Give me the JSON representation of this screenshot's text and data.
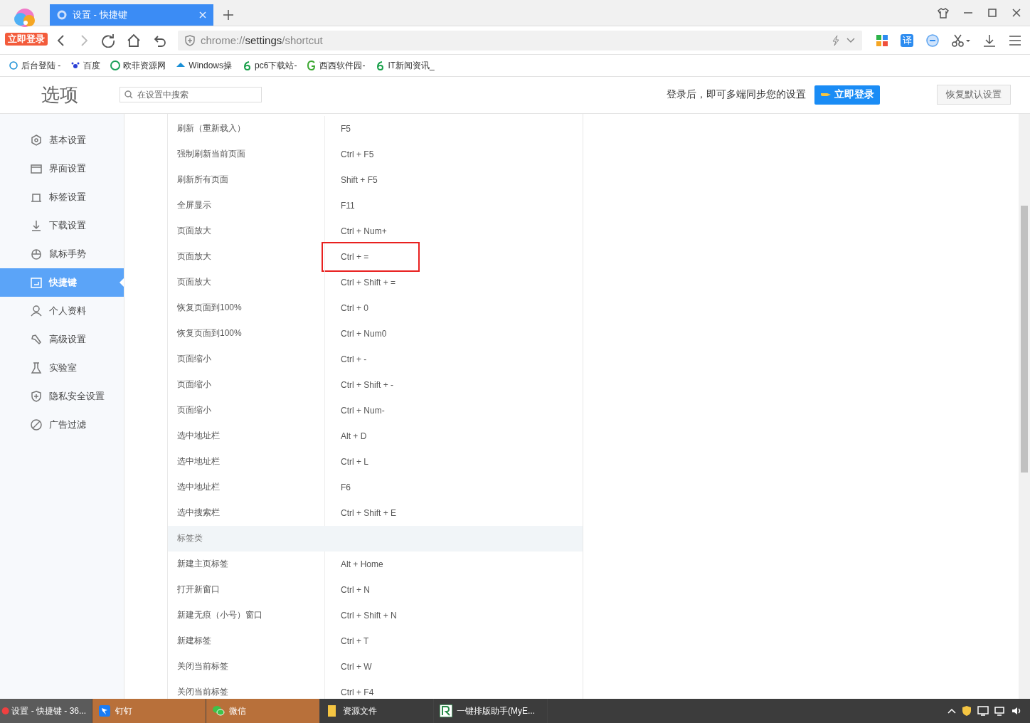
{
  "browser": {
    "badge": "立即登录",
    "tabs": [
      {
        "title": "设置 - 快捷键",
        "selected": true
      }
    ],
    "address": {
      "scheme": "chrome://",
      "host": "settings",
      "path": "/shortcut"
    },
    "translate_button": "译",
    "bookmarks": [
      "后台登陆 -",
      "百度",
      "欧菲资源网",
      "Windows操",
      "pc6下载站-",
      "西西软件园-",
      "IT新闻资讯_"
    ]
  },
  "header": {
    "title": "选项",
    "search_placeholder": "在设置中搜索",
    "sync_text": "登录后，即可多端同步您的设置",
    "login_button": "立即登录",
    "reset_button": "恢复默认设置"
  },
  "sidebar": {
    "items": [
      {
        "label": "基本设置",
        "selected": false
      },
      {
        "label": "界面设置",
        "selected": false
      },
      {
        "label": "标签设置",
        "selected": false
      },
      {
        "label": "下载设置",
        "selected": false
      },
      {
        "label": "鼠标手势",
        "selected": false
      },
      {
        "label": "快捷键",
        "selected": true
      },
      {
        "label": "个人资料",
        "selected": false
      },
      {
        "label": "高级设置",
        "selected": false
      },
      {
        "label": "实验室",
        "selected": false
      },
      {
        "label": "隐私安全设置",
        "selected": false
      },
      {
        "label": "广告过滤",
        "selected": false
      }
    ]
  },
  "shortcuts": {
    "rows": [
      {
        "kind": "shortcut",
        "action": "刷新（重新载入）",
        "keys": "F5",
        "highlighted": false
      },
      {
        "kind": "shortcut",
        "action": "强制刷新当前页面",
        "keys": "Ctrl + F5",
        "highlighted": false
      },
      {
        "kind": "shortcut",
        "action": "刷新所有页面",
        "keys": "Shift + F5",
        "highlighted": false
      },
      {
        "kind": "shortcut",
        "action": "全屏显示",
        "keys": "F11",
        "highlighted": false
      },
      {
        "kind": "shortcut",
        "action": "页面放大",
        "keys": "Ctrl + Num+",
        "highlighted": false
      },
      {
        "kind": "shortcut",
        "action": "页面放大",
        "keys": "Ctrl + =",
        "highlighted": true
      },
      {
        "kind": "shortcut",
        "action": "页面放大",
        "keys": "Ctrl + Shift + =",
        "highlighted": false
      },
      {
        "kind": "shortcut",
        "action": "恢复页面到100%",
        "keys": "Ctrl + 0",
        "highlighted": false
      },
      {
        "kind": "shortcut",
        "action": "恢复页面到100%",
        "keys": "Ctrl + Num0",
        "highlighted": false
      },
      {
        "kind": "shortcut",
        "action": "页面缩小",
        "keys": "Ctrl + -",
        "highlighted": false
      },
      {
        "kind": "shortcut",
        "action": "页面缩小",
        "keys": "Ctrl + Shift + -",
        "highlighted": false
      },
      {
        "kind": "shortcut",
        "action": "页面缩小",
        "keys": "Ctrl + Num-",
        "highlighted": false
      },
      {
        "kind": "shortcut",
        "action": "选中地址栏",
        "keys": "Alt + D",
        "highlighted": false
      },
      {
        "kind": "shortcut",
        "action": "选中地址栏",
        "keys": "Ctrl + L",
        "highlighted": false
      },
      {
        "kind": "shortcut",
        "action": "选中地址栏",
        "keys": "F6",
        "highlighted": false
      },
      {
        "kind": "shortcut",
        "action": "选中搜索栏",
        "keys": "Ctrl + Shift + E",
        "highlighted": false
      },
      {
        "kind": "section",
        "label": "标签类"
      },
      {
        "kind": "shortcut",
        "action": "新建主页标签",
        "keys": "Alt + Home",
        "highlighted": false
      },
      {
        "kind": "shortcut",
        "action": "打开新窗口",
        "keys": "Ctrl + N",
        "highlighted": false
      },
      {
        "kind": "shortcut",
        "action": "新建无痕（小号）窗口",
        "keys": "Ctrl + Shift + N",
        "highlighted": false
      },
      {
        "kind": "shortcut",
        "action": "新建标签",
        "keys": "Ctrl + T",
        "highlighted": false
      },
      {
        "kind": "shortcut",
        "action": "关闭当前标签",
        "keys": "Ctrl + W",
        "highlighted": false
      },
      {
        "kind": "shortcut",
        "action": "关闭当前标签",
        "keys": "Ctrl + F4",
        "highlighted": false
      }
    ]
  },
  "taskbar": {
    "items": [
      {
        "label": "设置 - 快捷键 - 36...",
        "selected": true
      },
      {
        "label": "钉钉",
        "selected": false
      },
      {
        "label": "微信",
        "selected": false
      },
      {
        "label": "资源文件",
        "selected": false
      },
      {
        "label": "一键排版助手(MyE...",
        "selected": false
      }
    ]
  }
}
